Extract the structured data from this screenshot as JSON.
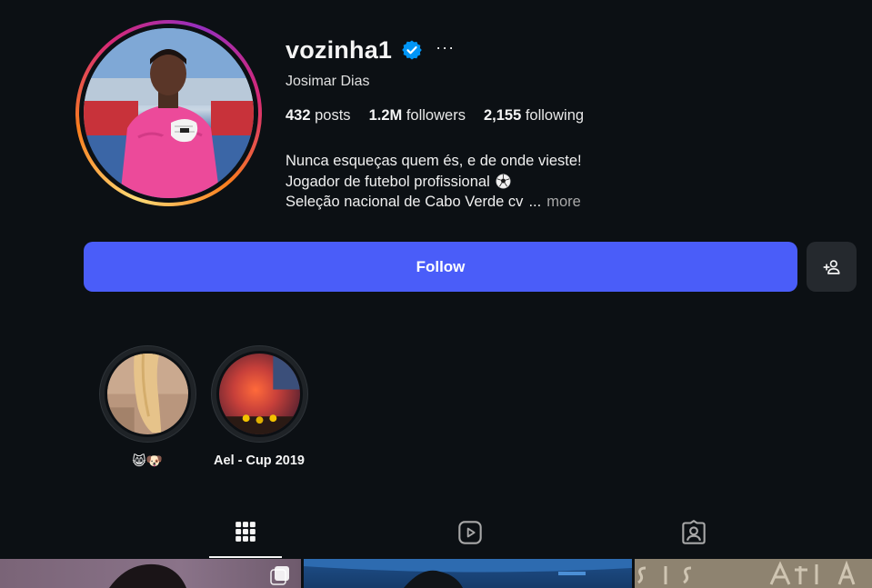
{
  "profile": {
    "username": "vozinha1",
    "verified": true,
    "full_name": "Josimar Dias",
    "more_options_label": "···"
  },
  "stats": {
    "posts_count": "432",
    "posts_label": "posts",
    "followers_count": "1.2M",
    "followers_label": "followers",
    "following_count": "2,155",
    "following_label": "following"
  },
  "bio": {
    "line1": "Nunca esqueças quem és, e de onde vieste!",
    "line2": "Jogador de futebol profissional",
    "line2_emoji": "soccer-ball-icon",
    "line3": "Seleção nacional de Cabo Verde cv",
    "ellipsis": "...",
    "more_label": "more"
  },
  "actions": {
    "follow_label": "Follow",
    "suggest_icon": "add-person-icon"
  },
  "highlights": [
    {
      "label": "😸🐶",
      "cover": "blonde-hair-photo"
    },
    {
      "label": "Ael - Cup 2019",
      "cover": "stadium-flare-photo"
    }
  ],
  "tabs": [
    {
      "name": "posts",
      "icon": "grid-icon",
      "active": true
    },
    {
      "name": "reels",
      "icon": "reels-icon",
      "active": false
    },
    {
      "name": "tagged",
      "icon": "tagged-icon",
      "active": false
    }
  ],
  "colors": {
    "background": "#0c1014",
    "follow_button": "#4a5df9",
    "verified_badge": "#0095f6",
    "secondary_button": "#25292e",
    "muted_text": "#a8a8a8"
  }
}
